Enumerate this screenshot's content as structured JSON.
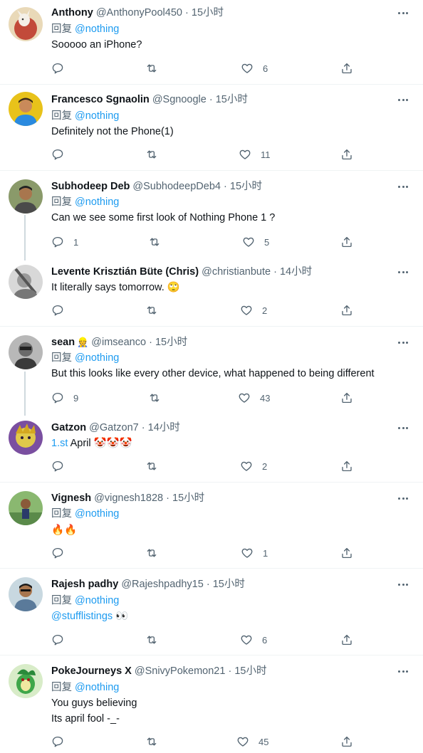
{
  "ui": {
    "reply_prefix": "回复",
    "dot": "·"
  },
  "tweets": [
    {
      "name": "Anthony",
      "handle": "@AnthonyPool450",
      "time": "15小时",
      "reply_to": "@nothing",
      "lines": [
        "Sooooo an iPhone?"
      ],
      "counts": {
        "reply": "",
        "retweet": "",
        "like": "6"
      },
      "avatar_color": "#c24a3a"
    },
    {
      "name": "Francesco Sgnaolin",
      "handle": "@Sgnoogle",
      "time": "15小时",
      "reply_to": "@nothing",
      "lines": [
        "Definitely not the Phone(1)"
      ],
      "counts": {
        "reply": "",
        "retweet": "",
        "like": "11"
      },
      "avatar_color": "#e8c21a"
    },
    {
      "name": "Subhodeep Deb",
      "handle": "@SubhodeepDeb4",
      "time": "15小时",
      "reply_to": "@nothing",
      "lines": [
        "Can we see some first look of Nothing Phone 1 ?"
      ],
      "counts": {
        "reply": "1",
        "retweet": "",
        "like": "5"
      },
      "avatar_color": "#6b7a5a"
    },
    {
      "name": "Levente Krisztián Büte (Chris)",
      "handle": "@christianbute",
      "time": "14小时",
      "reply_to": "",
      "lines": [
        "It literally says tomorrow. 🙄"
      ],
      "counts": {
        "reply": "",
        "retweet": "",
        "like": "2"
      },
      "avatar_color": "#8a8a8a"
    },
    {
      "name": "sean",
      "handle": "@imseanco",
      "time": "15小时",
      "badge": "👷",
      "reply_to": "@nothing",
      "lines": [
        "But this looks like every other device, what happened to being different"
      ],
      "counts": {
        "reply": "9",
        "retweet": "",
        "like": "43"
      },
      "avatar_color": "#5a5a5a"
    },
    {
      "name": "Gatzon",
      "handle": "@Gatzon7",
      "time": "14小时",
      "reply_to": "",
      "lines": [
        "1.st April 🤡🤡🤡"
      ],
      "link_prefix": "1.st",
      "counts": {
        "reply": "",
        "retweet": "",
        "like": "2"
      },
      "avatar_color": "#7a4fa0"
    },
    {
      "name": "Vignesh",
      "handle": "@vignesh1828",
      "time": "15小时",
      "reply_to": "@nothing",
      "lines": [
        "🔥🔥"
      ],
      "counts": {
        "reply": "",
        "retweet": "",
        "like": "1"
      },
      "avatar_color": "#5a8a4a"
    },
    {
      "name": "Rajesh padhy",
      "handle": "@Rajeshpadhy15",
      "time": "15小时",
      "reply_to": "@nothing",
      "lines": [
        "@stufflistings 👀"
      ],
      "counts": {
        "reply": "",
        "retweet": "",
        "like": "6"
      },
      "avatar_color": "#7a9ab0"
    },
    {
      "name": "PokeJourneys X",
      "handle": "@SnivyPokemon21",
      "time": "15小时",
      "reply_to": "@nothing",
      "lines": [
        "You guys believing",
        "Its april fool -_-"
      ],
      "counts": {
        "reply": "",
        "retweet": "",
        "like": "45"
      },
      "avatar_color": "#3fa64a"
    }
  ]
}
